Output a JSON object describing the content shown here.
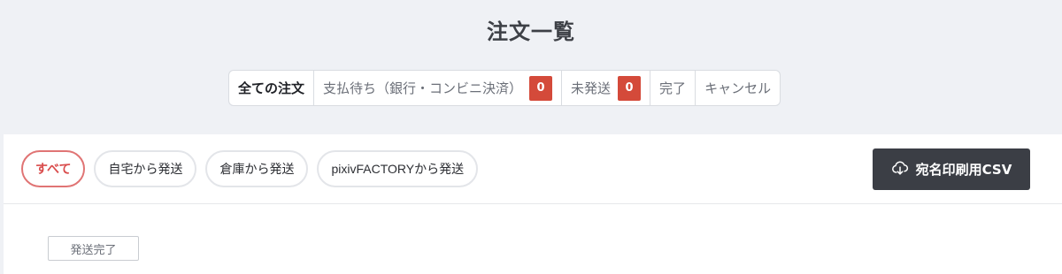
{
  "header": {
    "title": "注文一覧"
  },
  "status_tabs": [
    {
      "label": "全ての注文",
      "active": true
    },
    {
      "label": "支払待ち（銀行・コンビニ決済）",
      "count": "0"
    },
    {
      "label": "未発送",
      "count": "0"
    },
    {
      "label": "完了"
    },
    {
      "label": "キャンセル"
    }
  ],
  "filters": [
    {
      "label": "すべて",
      "active": true
    },
    {
      "label": "自宅から発送"
    },
    {
      "label": "倉庫から発送"
    },
    {
      "label": "pixivFACTORYから発送"
    }
  ],
  "csv_button": {
    "label": "宛名印刷用CSV",
    "icon": "cloud-download-icon"
  },
  "orders": [
    {
      "status": "発送完了"
    }
  ],
  "colors": {
    "background": "#eff1f5",
    "badge": "#d44a3a",
    "active_filter": "#e07474",
    "dark_button": "#3b3e45"
  }
}
